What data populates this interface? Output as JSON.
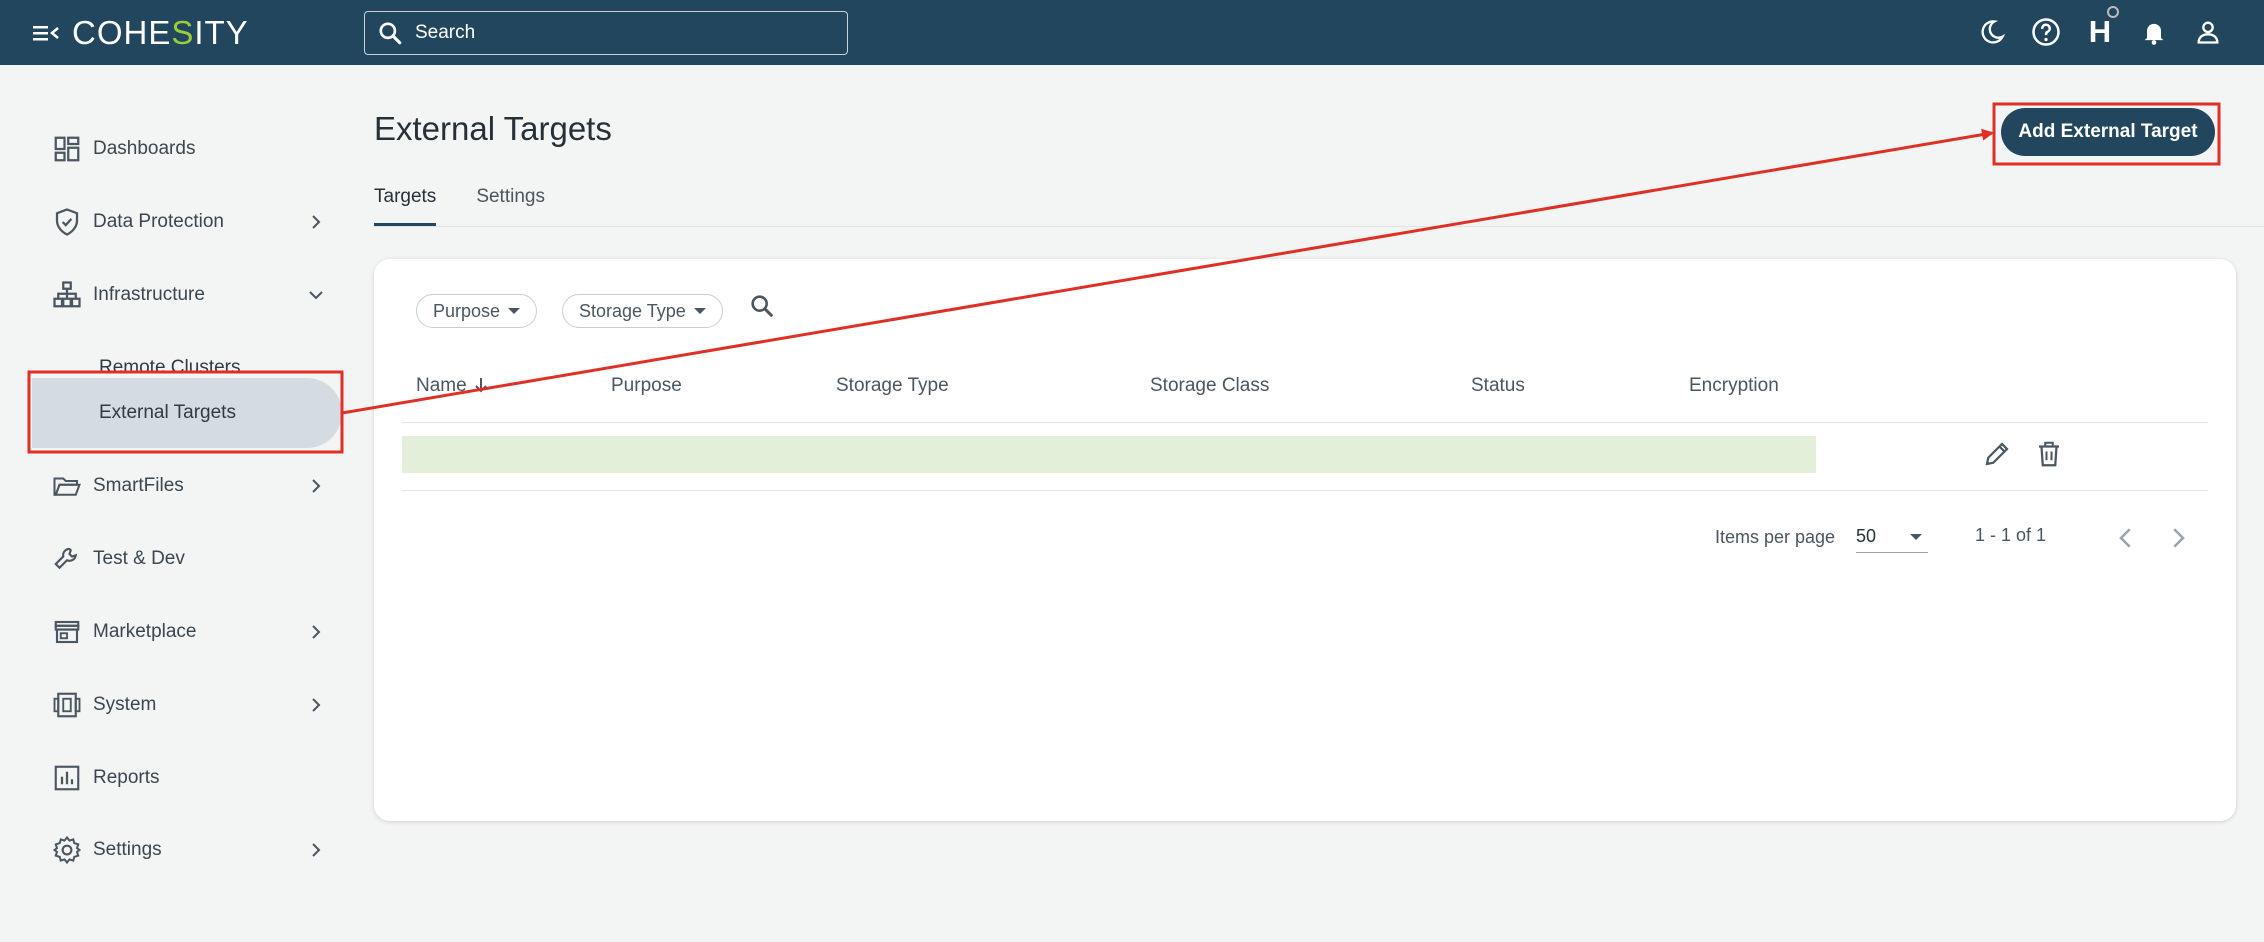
{
  "header": {
    "logo_prefix": "COHE",
    "logo_s": "S",
    "logo_suffix": "ITY",
    "search_placeholder": "Search"
  },
  "sidebar": {
    "items": [
      {
        "label": "Dashboards",
        "icon": "dashboard-icon"
      },
      {
        "label": "Data Protection",
        "icon": "shield-icon"
      },
      {
        "label": "Infrastructure",
        "icon": "network-icon"
      },
      {
        "label": "Remote Clusters"
      },
      {
        "label": "External Targets"
      },
      {
        "label": "SmartFiles",
        "icon": "folder-icon"
      },
      {
        "label": "Test & Dev",
        "icon": "wrench-icon"
      },
      {
        "label": "Marketplace",
        "icon": "store-icon"
      },
      {
        "label": "System",
        "icon": "system-icon"
      },
      {
        "label": "Reports",
        "icon": "report-icon"
      },
      {
        "label": "Settings",
        "icon": "gear-icon"
      }
    ]
  },
  "main": {
    "title": "External Targets",
    "add_button": "Add External Target",
    "tabs": [
      {
        "label": "Targets"
      },
      {
        "label": "Settings"
      }
    ],
    "filters": {
      "purpose": "Purpose",
      "storage_type": "Storage Type"
    },
    "columns": [
      "Name",
      "Purpose",
      "Storage Type",
      "Storage Class",
      "Status",
      "Encryption"
    ],
    "pagination": {
      "items_per_page_label": "Items per page",
      "items_per_page_value": "50",
      "range": "1 - 1 of 1"
    }
  },
  "colors": {
    "topbar": "#23465f",
    "logo_accent": "#9ccc3c",
    "annotation": "#e03026",
    "row_highlight": "#e3efd9"
  }
}
